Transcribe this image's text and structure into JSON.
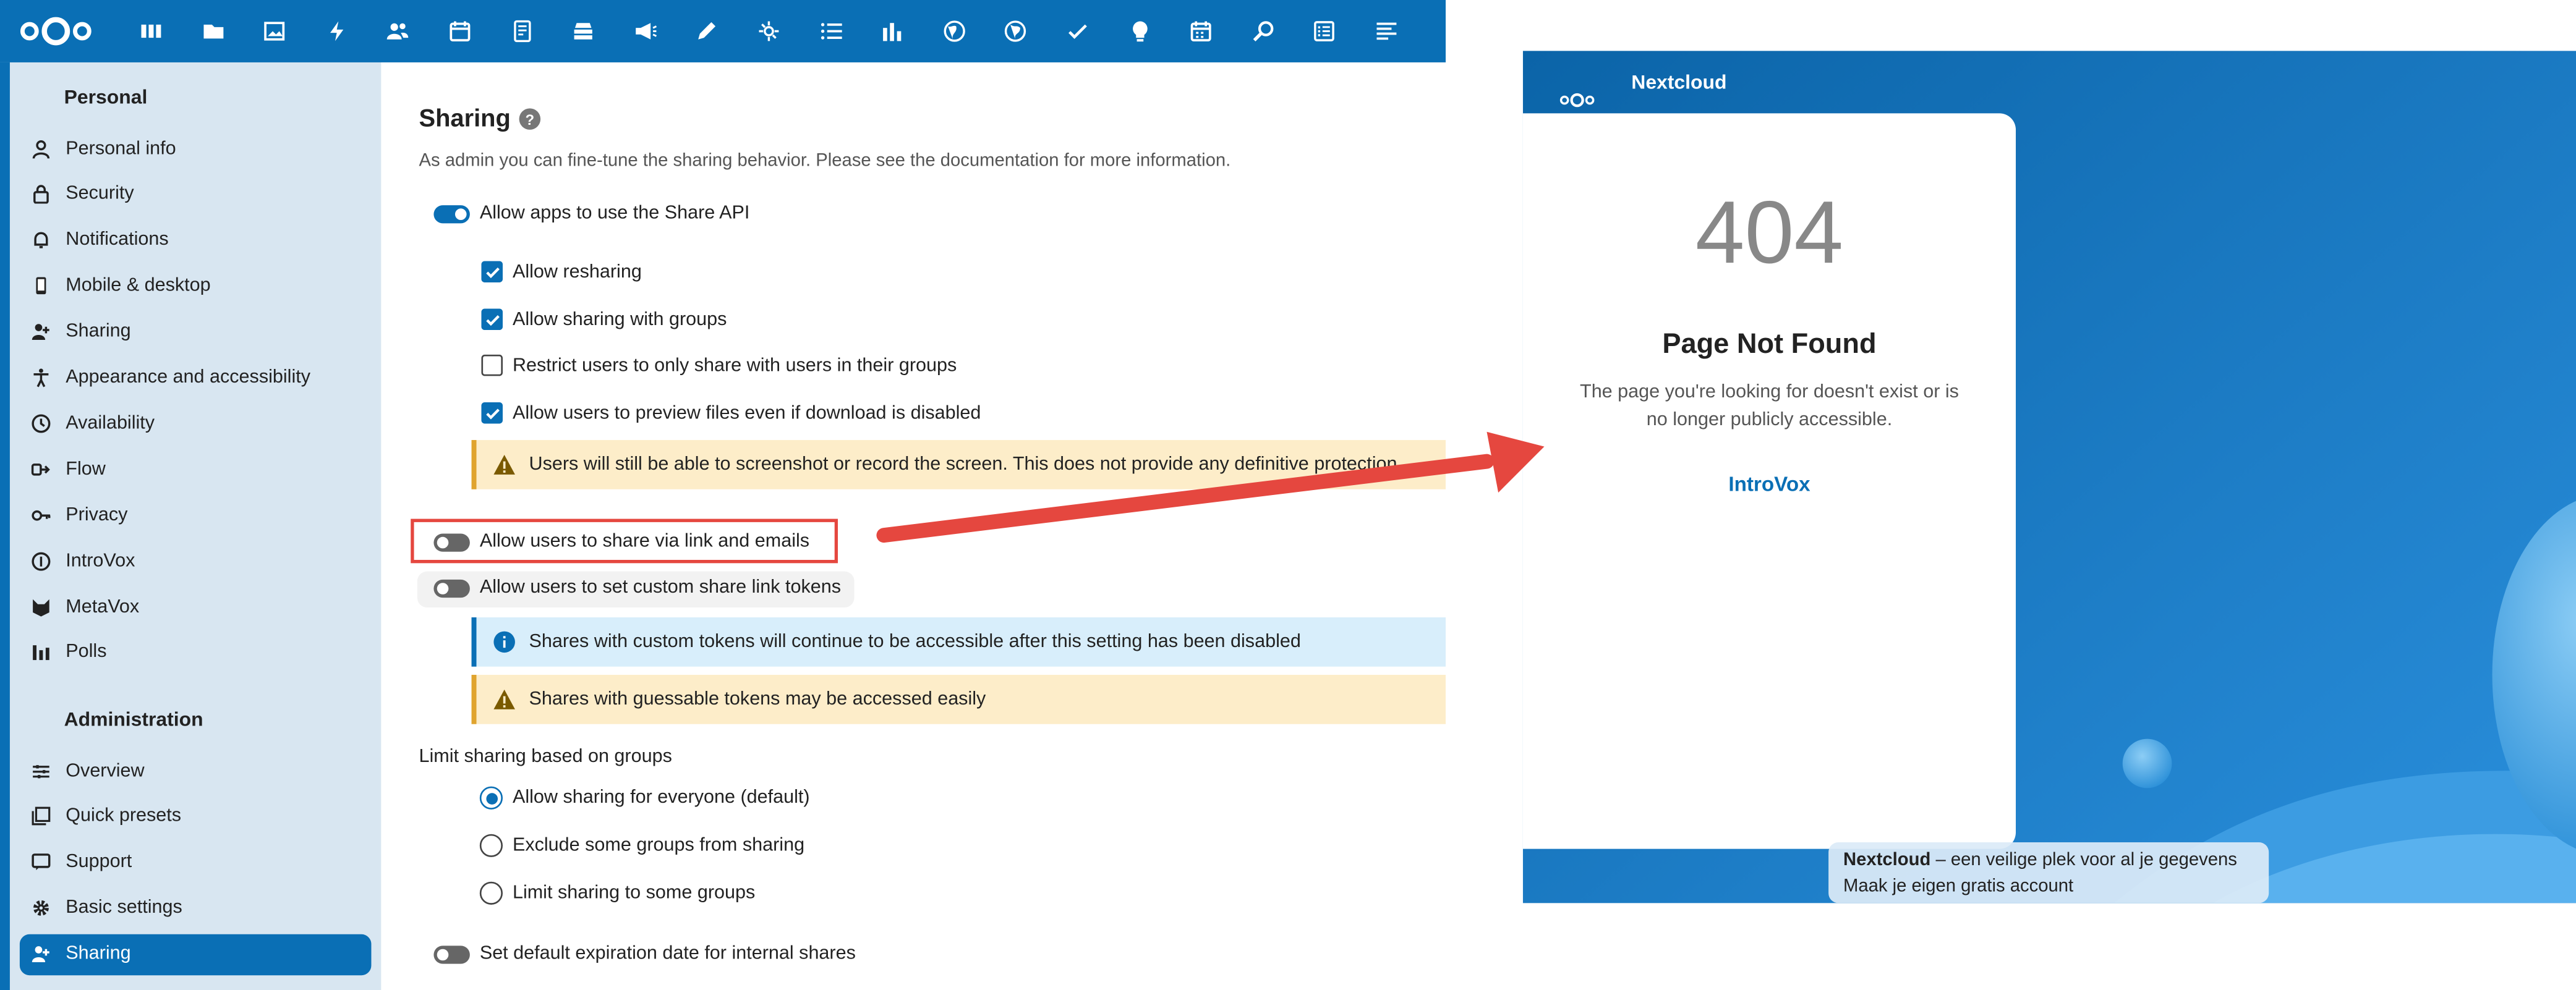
{
  "settings": {
    "sidebar": {
      "personal_heading": "Personal",
      "personal_items": [
        {
          "label": "Personal info",
          "icon": "user-icon"
        },
        {
          "label": "Security",
          "icon": "lock-icon"
        },
        {
          "label": "Notifications",
          "icon": "bell-icon"
        },
        {
          "label": "Mobile & desktop",
          "icon": "phone-icon"
        },
        {
          "label": "Sharing",
          "icon": "share-user-icon"
        },
        {
          "label": "Appearance and accessibility",
          "icon": "accessibility-icon"
        },
        {
          "label": "Availability",
          "icon": "clock-icon"
        },
        {
          "label": "Flow",
          "icon": "flow-icon"
        },
        {
          "label": "Privacy",
          "icon": "key-icon"
        },
        {
          "label": "IntroVox",
          "icon": "introvox-icon"
        },
        {
          "label": "MetaVox",
          "icon": "metavox-icon"
        },
        {
          "label": "Polls",
          "icon": "poll-icon"
        }
      ],
      "admin_heading": "Administration",
      "admin_items": [
        {
          "label": "Overview",
          "icon": "sliders-icon"
        },
        {
          "label": "Quick presets",
          "icon": "presets-icon"
        },
        {
          "label": "Support",
          "icon": "support-icon"
        },
        {
          "label": "Basic settings",
          "icon": "gear-icon"
        },
        {
          "label": "Sharing",
          "icon": "share-user-icon",
          "active": true
        }
      ]
    },
    "main": {
      "title": "Sharing",
      "help_glyph": "?",
      "description": "As admin you can fine-tune the sharing behavior. Please see the documentation for more information.",
      "share_api": {
        "label": "Allow apps to use the Share API",
        "enabled": true
      },
      "checkboxes": [
        {
          "label": "Allow resharing",
          "checked": true
        },
        {
          "label": "Allow sharing with groups",
          "checked": true
        },
        {
          "label": "Restrict users to only share with users in their groups",
          "checked": false
        },
        {
          "label": "Allow users to preview files even if download is disabled",
          "checked": true
        }
      ],
      "preview_warning": "Users will still be able to screenshot or record the screen. This does not provide any definitive protection.",
      "share_link": {
        "label": "Allow users to share via link and emails",
        "enabled": false
      },
      "custom_tokens": {
        "label": "Allow users to set custom share link tokens",
        "enabled": false
      },
      "tokens_info": "Shares with custom tokens will continue to be accessible after this setting has been disabled",
      "tokens_warning": "Shares with guessable tokens may be accessed easily",
      "limit_heading": "Limit sharing based on groups",
      "radios": [
        {
          "label": "Allow sharing for everyone (default)",
          "selected": true
        },
        {
          "label": "Exclude some groups from sharing",
          "selected": false
        },
        {
          "label": "Limit sharing to some groups",
          "selected": false
        }
      ],
      "expiration": {
        "label": "Set default expiration date for internal shares",
        "enabled": false
      }
    }
  },
  "not_found": {
    "brand": "Nextcloud",
    "code": "404",
    "title": "Page Not Found",
    "description": "The page you're looking for doesn't exist or is no longer publicly accessible.",
    "link": "IntroVox",
    "footer_brand": "Nextcloud",
    "footer_tagline": " – een veilige plek voor al je gegevens",
    "footer_cta": "Maak je eigen gratis account"
  },
  "colors": {
    "primary": "#0a6fb5",
    "highlight_box": "#e5473f",
    "warning_bg": "#fdedc9",
    "info_bg": "#d8eefb"
  }
}
